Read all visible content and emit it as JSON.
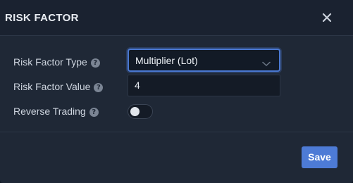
{
  "dialog": {
    "title": "RISK FACTOR",
    "close_icon": "close-icon"
  },
  "fields": {
    "risk_factor_type": {
      "label": "Risk Factor Type",
      "help_icon": "question-circle-icon",
      "help_glyph": "?",
      "selected_value": "Multiplier (Lot)"
    },
    "risk_factor_value": {
      "label": "Risk Factor Value",
      "help_icon": "question-circle-icon",
      "help_glyph": "?",
      "value": "4"
    },
    "reverse_trading": {
      "label": "Reverse Trading",
      "help_icon": "question-circle-icon",
      "help_glyph": "?",
      "enabled": false
    }
  },
  "footer": {
    "save_label": "Save"
  },
  "colors": {
    "accent": "#4d7bd6",
    "panel_bg": "#1f2836",
    "text": "#cfd6e0"
  }
}
